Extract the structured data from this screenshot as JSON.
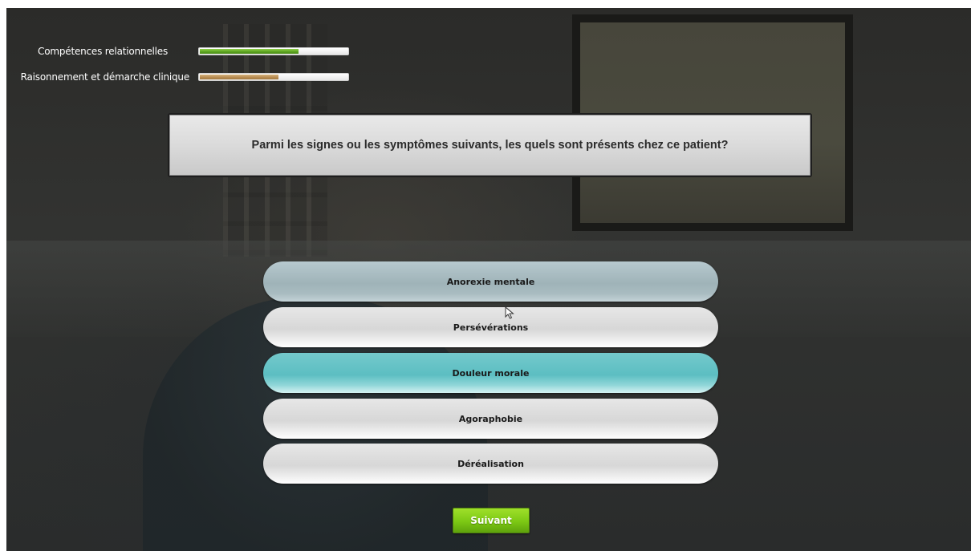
{
  "skills": [
    {
      "label": "Compétences relationnelles",
      "progress": 0.67,
      "color": "#5aa21f"
    },
    {
      "label": "Raisonnement et démarche clinique",
      "progress": 0.54,
      "color": "#b78b4f"
    }
  ],
  "question": {
    "text": "Parmi les signes ou les symptômes suivants, les quels sont présents chez ce patient?"
  },
  "options": [
    {
      "label": "Anorexie mentale",
      "state": "hover"
    },
    {
      "label": "Persévérations",
      "state": "default"
    },
    {
      "label": "Douleur morale",
      "state": "selected"
    },
    {
      "label": "Agoraphobie",
      "state": "default"
    },
    {
      "label": "Déréalisation",
      "state": "default"
    }
  ],
  "next_button": {
    "label": "Suivant",
    "color": "#7cc814"
  },
  "icons": {
    "cursor": "mouse-pointer-icon"
  }
}
